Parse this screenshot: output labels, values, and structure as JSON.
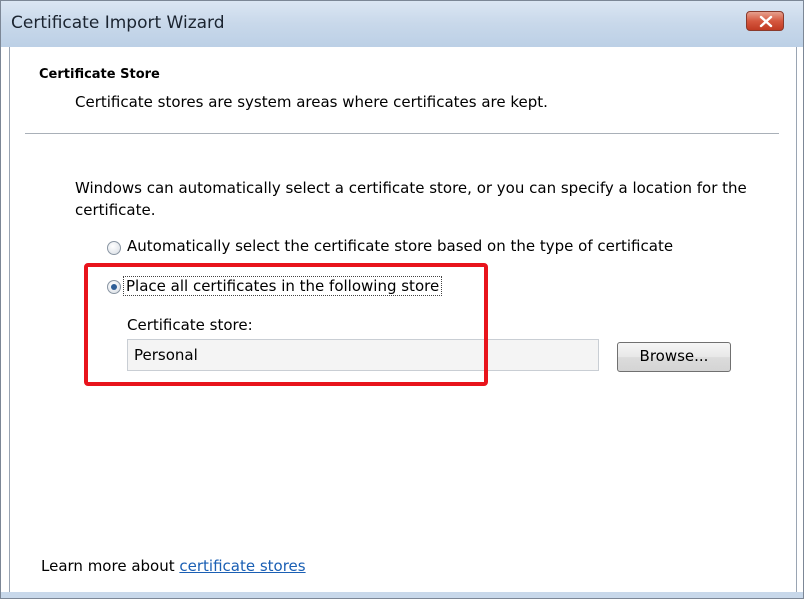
{
  "window": {
    "title": "Certificate Import Wizard",
    "close_icon": "close-icon"
  },
  "header": {
    "title": "Certificate Store",
    "description": "Certificate stores are system areas where certificates are kept."
  },
  "body": {
    "intro": "Windows can automatically select a certificate store, or you can specify a location for the certificate.",
    "options": [
      {
        "label": "Automatically select the certificate store based on the type of certificate",
        "checked": false
      },
      {
        "label": "Place all certificates in the following store",
        "checked": true
      }
    ],
    "store_label": "Certificate store:",
    "store_value": "Personal",
    "browse_label": "Browse..."
  },
  "footer": {
    "learn_prefix": "Learn more about",
    "learn_link": "certificate stores"
  },
  "colors": {
    "highlight": "#e8141c",
    "link": "#1a5fb4"
  }
}
